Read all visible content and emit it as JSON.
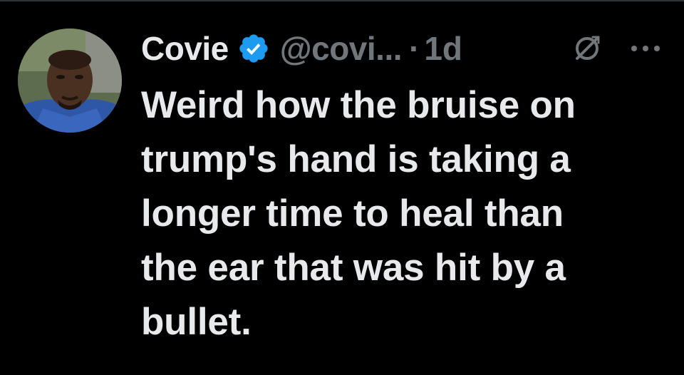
{
  "tweet": {
    "display_name": "Covie",
    "handle": "@covi...",
    "separator": "·",
    "timestamp": "1d",
    "text_lines": [
      "Weird how the bruise on",
      "trump's hand is taking a",
      "longer time to heal than",
      "the ear that was hit by a",
      "bullet."
    ]
  },
  "icons": {
    "verified": "verified-badge-icon",
    "grok": "grok-icon",
    "more": "more-options-icon"
  },
  "colors": {
    "background": "#000000",
    "primary_text": "#e7e9ea",
    "secondary_text": "#71767b",
    "verified_blue": "#1d9bf0"
  }
}
